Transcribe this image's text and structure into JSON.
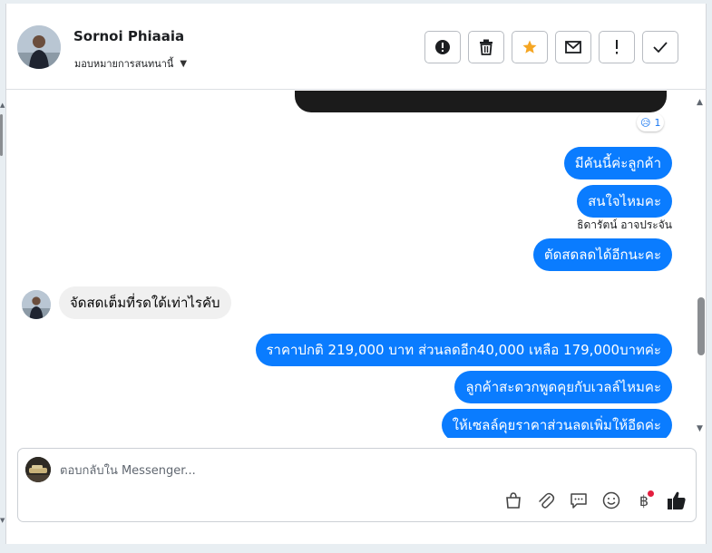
{
  "header": {
    "contact_name": "Sornoi Phiaaia",
    "assign_label": "มอบหมายการสนทนานี้",
    "actions": [
      {
        "name": "report-button",
        "icon": "alert-circle-icon"
      },
      {
        "name": "delete-button",
        "icon": "trash-icon"
      },
      {
        "name": "star-button",
        "icon": "star-icon"
      },
      {
        "name": "mark-unread-button",
        "icon": "envelope-icon"
      },
      {
        "name": "important-button",
        "icon": "exclamation-icon"
      },
      {
        "name": "done-button",
        "icon": "checkmark-icon"
      }
    ]
  },
  "conversation": {
    "reaction": {
      "emoji": "😥",
      "count": "1"
    },
    "sender_note": "ธิดารัตน์ อาจประจัน",
    "messages": [
      {
        "dir": "out",
        "text": "มีคันนี้ค่ะลูกค้า"
      },
      {
        "dir": "out",
        "text": "สนใจไหมคะ"
      },
      {
        "dir": "out",
        "text": "ตัดสดลดได้อีกนะคะ"
      },
      {
        "dir": "in",
        "text": "จัดสดเต็มที่รดใด้เท่าไรคับ"
      },
      {
        "dir": "out",
        "text": "ราคาปกติ 219,000 บาท ส่วนลดอีก40,000 เหลือ 179,000บาทค่ะ"
      },
      {
        "dir": "out",
        "text": "ลูกค้าสะดวกพูดคุยกับเวลล์ไหมคะ"
      },
      {
        "dir": "out",
        "text": "ให้เซลล์คุยราคาส่วนลดเพิ่มให้อีดค่ะ"
      }
    ]
  },
  "composer": {
    "placeholder": "ตอบกลับใน Messenger...",
    "baht_symbol": "฿",
    "tools": [
      "bag-icon",
      "paperclip-icon",
      "chat-bubble-icon",
      "smiley-icon",
      "baht-icon",
      "thumbs-up-icon"
    ]
  },
  "colors": {
    "outgoing_bubble": "#0a7cff",
    "incoming_bubble": "#f0f0f0",
    "notification_dot": "#e41e3f",
    "star": "#f5a623"
  }
}
